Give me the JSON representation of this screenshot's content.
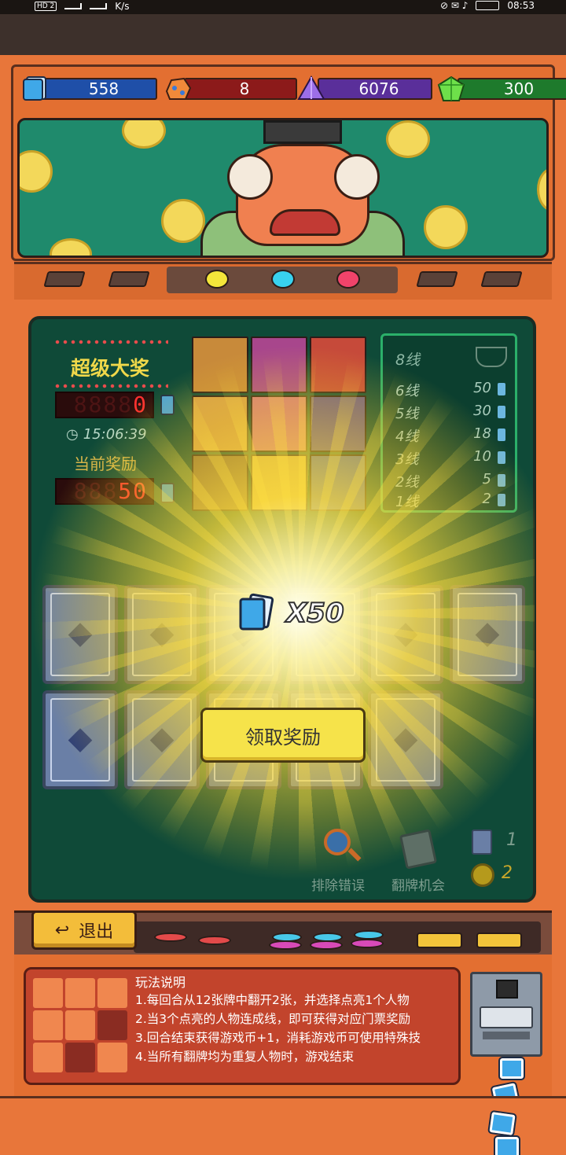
{
  "status_bar": {
    "network": "K/s",
    "time": "08:53",
    "hd": "HD 2"
  },
  "resources": [
    {
      "name": "ticket",
      "value": "558",
      "color": "#1f4fa8"
    },
    {
      "name": "ore",
      "value": "8",
      "color": "#8c1a1a"
    },
    {
      "name": "crystal",
      "value": "6076",
      "color": "#5a2f9a"
    },
    {
      "name": "gem",
      "value": "300",
      "color": "#1e7a2c"
    }
  ],
  "jackpot": {
    "title": "超级大奖",
    "counter": "0",
    "counter_ghost": "8888",
    "timer": "15:06:39",
    "current_title": "当前奖励",
    "current_value": "50",
    "current_ghost": "888"
  },
  "payout_table": {
    "header": "8线",
    "rows": [
      {
        "label": "6线",
        "value": "50"
      },
      {
        "label": "5线",
        "value": "30"
      },
      {
        "label": "4线",
        "value": "18"
      },
      {
        "label": "3线",
        "value": "10"
      },
      {
        "label": "2线",
        "value": "5"
      },
      {
        "label": "1线",
        "value": "2"
      }
    ]
  },
  "reward_popup": {
    "multiplier": "X50",
    "claim_label": "领取奖励"
  },
  "tools": {
    "remove_error_label": "排除错误",
    "flip_chance_label": "翻牌机会",
    "card_count": "1",
    "coin_count": "2"
  },
  "exit_label": "退出",
  "rules": {
    "title": "玩法说明",
    "lines": [
      "1.每回合从12张牌中翻开2张，并选择点亮1个人物",
      "2.当3个点亮的人物连成线，即可获得对应门票奖励",
      "3.回合结束获得游戏币+1，消耗游戏币可使用特殊技",
      "4.当所有翻牌均为重复人物时，游戏结束"
    ]
  },
  "lamps": [
    "#f4e63a",
    "#38d2ef",
    "#f0436a"
  ]
}
